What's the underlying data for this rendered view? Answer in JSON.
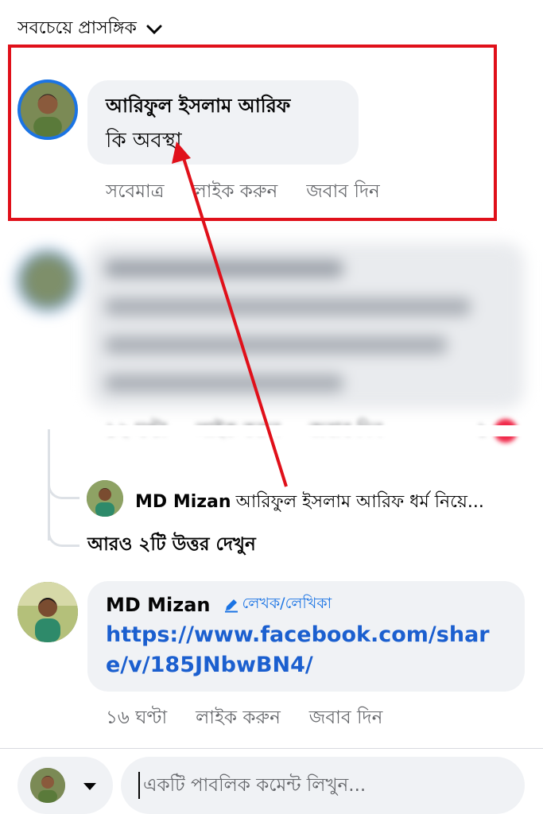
{
  "sort": {
    "label": "সবচেয়ে প্রাসঙ্গিক"
  },
  "comment1": {
    "author": "আরিফুল ইসলাম আরিফ",
    "text": "কি অবস্থা",
    "time": "সবেমাত্র",
    "like": "লাইক করুন",
    "reply": "জবাব দিন"
  },
  "comment2": {
    "time": "১২ ঘণ্টা",
    "like": "লাইক করুন",
    "reply": "জবাব দিন",
    "reaction_count": "১"
  },
  "reply_preview": {
    "author": "MD Mizan",
    "text": "আরিফুল ইসলাম আরিফ ধর্ম নিয়ে..."
  },
  "more_replies": "আরও ২টি উত্তর দেখুন",
  "comment3": {
    "author": "MD Mizan",
    "badge": "লেখক/লেখিকা",
    "link": "https://www.facebook.com/share/v/185JNbwBN4/",
    "time": "১৬ ঘণ্টা",
    "like": "লাইক করুন",
    "reply": "জবাব দিন"
  },
  "composer": {
    "placeholder": "একটি পাবলিক কমেন্ট লিখুন..."
  },
  "colors": {
    "annotation_red": "#e0101a",
    "link_blue": "#1b5fcf",
    "bubble": "#f0f2f5"
  }
}
